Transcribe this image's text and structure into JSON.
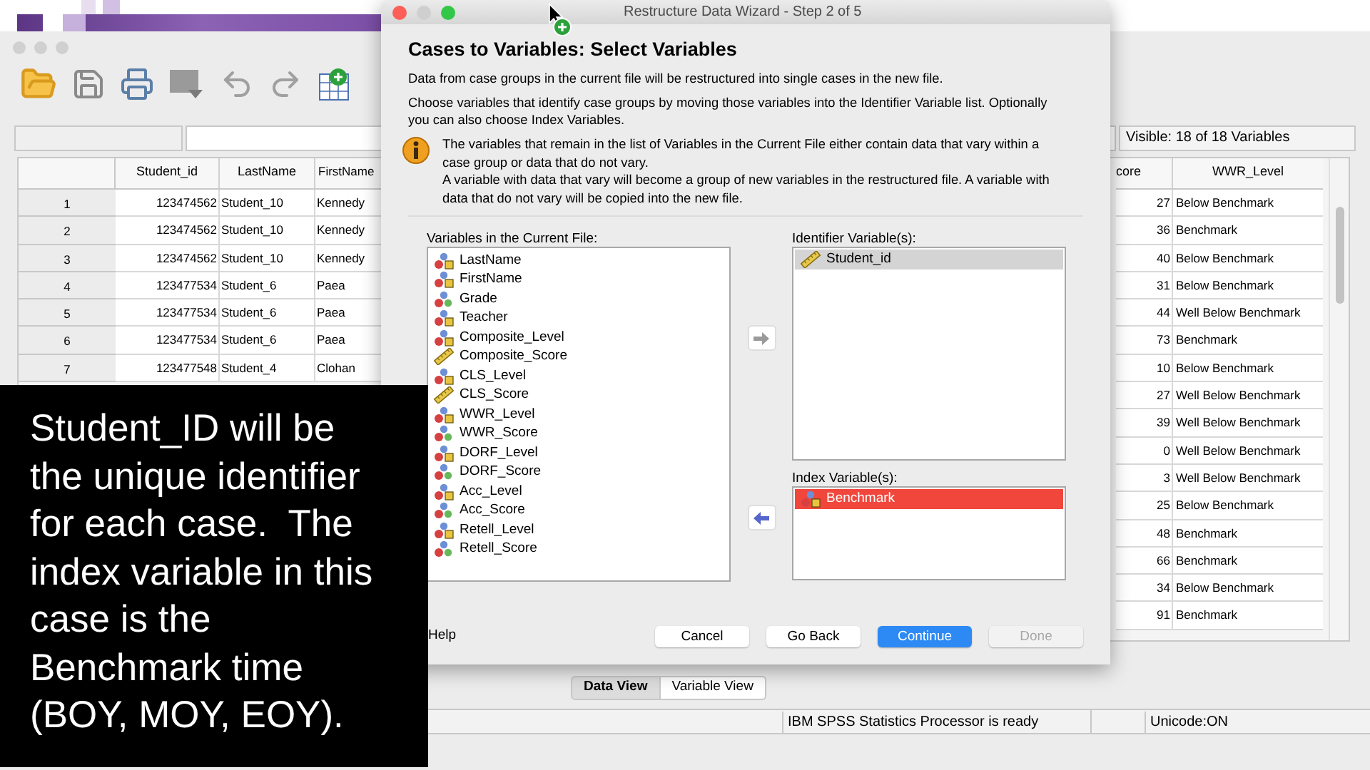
{
  "data_editor": {
    "visible_count": "Visible: 18 of 18 Variables",
    "columns": [
      "Student_id",
      "LastName",
      "FirstName",
      "core",
      "WWR_Level"
    ],
    "rows": [
      {
        "number": "1",
        "left_cells": [
          "123474562",
          "Student_10",
          "Kennedy"
        ],
        "right_cells": [
          "27",
          "Below Benchmark"
        ]
      },
      {
        "number": "2",
        "left_cells": [
          "123474562",
          "Student_10",
          "Kennedy"
        ],
        "right_cells": [
          "36",
          "Benchmark"
        ]
      },
      {
        "number": "3",
        "left_cells": [
          "123474562",
          "Student_10",
          "Kennedy"
        ],
        "right_cells": [
          "40",
          "Below Benchmark"
        ]
      },
      {
        "number": "4",
        "left_cells": [
          "123477534",
          "Student_6",
          "Paea"
        ],
        "right_cells": [
          "31",
          "Below Benchmark"
        ]
      },
      {
        "number": "5",
        "left_cells": [
          "123477534",
          "Student_6",
          "Paea"
        ],
        "right_cells": [
          "44",
          "Well Below Benchmark"
        ]
      },
      {
        "number": "6",
        "left_cells": [
          "123477534",
          "Student_6",
          "Paea"
        ],
        "right_cells": [
          "73",
          "Benchmark"
        ]
      },
      {
        "number": "7",
        "left_cells": [
          "123477548",
          "Student_4",
          "Clohan"
        ],
        "right_cells": [
          "10",
          "Below Benchmark"
        ]
      },
      {
        "right_cells": [
          "27",
          "Well Below Benchmark"
        ]
      },
      {
        "right_cells": [
          "39",
          "Well Below Benchmark"
        ]
      },
      {
        "right_cells": [
          "0",
          "Well Below Benchmark"
        ]
      },
      {
        "right_cells": [
          "3",
          "Well Below Benchmark"
        ]
      },
      {
        "right_cells": [
          "25",
          "Below Benchmark"
        ]
      },
      {
        "right_cells": [
          "48",
          "Benchmark"
        ]
      },
      {
        "right_cells": [
          "66",
          "Benchmark"
        ]
      },
      {
        "right_cells": [
          "34",
          "Below Benchmark"
        ]
      },
      {
        "right_cells": [
          "91",
          "Benchmark"
        ]
      }
    ],
    "view_tabs": [
      {
        "label": "Data View",
        "selected": true
      },
      {
        "label": "Variable View",
        "selected": false
      }
    ],
    "status_bar": [
      "IBM SPSS Statistics Processor is ready",
      "Unicode:ON"
    ]
  },
  "dialog": {
    "title": "Restructure Data Wizard - Step 2 of 5",
    "heading": "Cases to Variables: Select Variables",
    "intro": [
      "Data from case groups in the current file will be restructured into single cases in the new file.",
      "Choose variables that identify case groups by moving those variables into the Identifier Variable list.  Optionally you can also choose Index Variables."
    ],
    "info": [
      "The variables that remain in the list of Variables in the Current File either contain data that vary within a case group or data that do not vary.",
      "A variable with data that vary will become a group of new variables in the restructured file.  A variable with data that do not vary will be copied into the new file."
    ],
    "current_label": "Variables in the Current File:",
    "current_variables": [
      {
        "name": "LastName",
        "kind": "string"
      },
      {
        "name": "FirstName",
        "kind": "string"
      },
      {
        "name": "Grade",
        "kind": "numeric"
      },
      {
        "name": "Teacher",
        "kind": "string"
      },
      {
        "name": "Composite_Level",
        "kind": "string"
      },
      {
        "name": "Composite_Score",
        "kind": "scale"
      },
      {
        "name": "CLS_Level",
        "kind": "string"
      },
      {
        "name": "CLS_Score",
        "kind": "scale"
      },
      {
        "name": "WWR_Level",
        "kind": "string"
      },
      {
        "name": "WWR_Score",
        "kind": "numeric"
      },
      {
        "name": "DORF_Level",
        "kind": "string"
      },
      {
        "name": "DORF_Score",
        "kind": "numeric"
      },
      {
        "name": "Acc_Level",
        "kind": "string"
      },
      {
        "name": "Acc_Score",
        "kind": "numeric"
      },
      {
        "name": "Retell_Level",
        "kind": "string"
      },
      {
        "name": "Retell_Score",
        "kind": "numeric"
      }
    ],
    "identifier_label": "Identifier Variable(s):",
    "identifier_variables": [
      {
        "name": "Student_id",
        "kind": "scale",
        "selected": true
      }
    ],
    "index_label": "Index Variable(s):",
    "index_variables": [
      {
        "name": "Benchmark",
        "kind": "string",
        "selected": true
      }
    ],
    "help": "Help",
    "buttons": [
      {
        "label": "Cancel",
        "primary": false,
        "disabled": false
      },
      {
        "label": "Go Back",
        "primary": false,
        "disabled": false
      },
      {
        "label": "Continue",
        "primary": true,
        "disabled": false
      },
      {
        "label": "Done",
        "primary": false,
        "disabled": true
      }
    ]
  },
  "callout": {
    "text": "Student_ID will be the unique identifier for each case.  The index variable in this case is the Benchmark time (BOY, MOY, EOY)."
  }
}
